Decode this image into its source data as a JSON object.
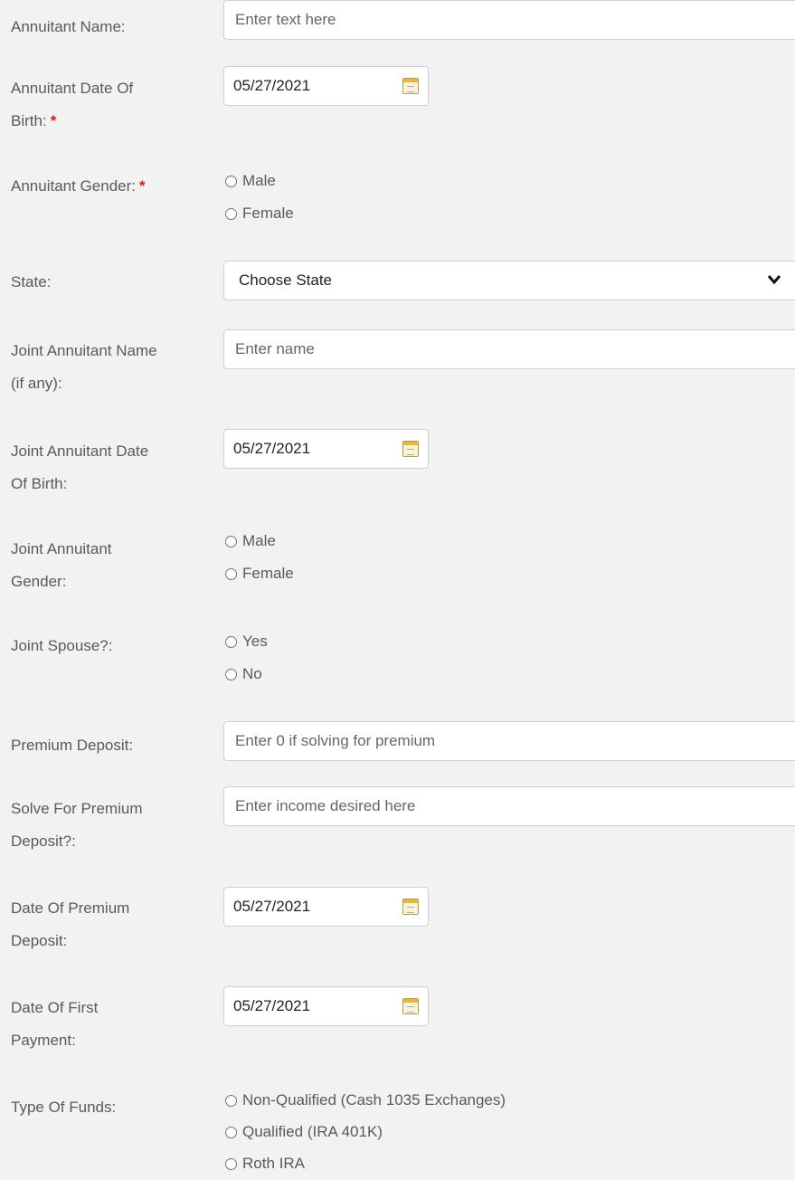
{
  "annuitant_name": {
    "label": "Annuitant Name:",
    "placeholder": "Enter text here"
  },
  "annuitant_dob": {
    "label_line1": "Annuitant Date Of",
    "label_line2": "Birth:",
    "required_mark": "*",
    "value": "05/27/2021"
  },
  "annuitant_gender": {
    "label": "Annuitant Gender:",
    "required_mark": "*",
    "options": [
      "Male",
      "Female"
    ]
  },
  "state": {
    "label": "State:",
    "selected": "Choose State"
  },
  "joint_name": {
    "label_line1": "Joint Annuitant Name",
    "label_line2": "(if any):",
    "placeholder": "Enter name"
  },
  "joint_dob": {
    "label_line1": "Joint Annuitant Date",
    "label_line2": "Of Birth:",
    "value": "05/27/2021"
  },
  "joint_gender": {
    "label_line1": "Joint Annuitant",
    "label_line2": "Gender:",
    "options": [
      "Male",
      "Female"
    ]
  },
  "joint_spouse": {
    "label": "Joint Spouse?:",
    "options": [
      "Yes",
      "No"
    ]
  },
  "premium_deposit": {
    "label": "Premium Deposit:",
    "placeholder": "Enter 0 if solving for premium"
  },
  "solve_premium": {
    "label_line1": "Solve For Premium",
    "label_line2": "Deposit?:",
    "placeholder": "Enter income desired here"
  },
  "premium_date": {
    "label_line1": "Date Of Premium",
    "label_line2": "Deposit:",
    "value": "05/27/2021"
  },
  "first_payment_date": {
    "label_line1": "Date Of First",
    "label_line2": "Payment:",
    "value": "05/27/2021"
  },
  "fund_type": {
    "label": "Type Of Funds:",
    "options": [
      "Non-Qualified (Cash 1035 Exchanges)",
      "Qualified (IRA 401K)",
      "Roth IRA"
    ]
  },
  "icons": {
    "calendar": "calendar-icon",
    "dropdown": "chevron-down-icon",
    "radio": "radio-circle"
  }
}
